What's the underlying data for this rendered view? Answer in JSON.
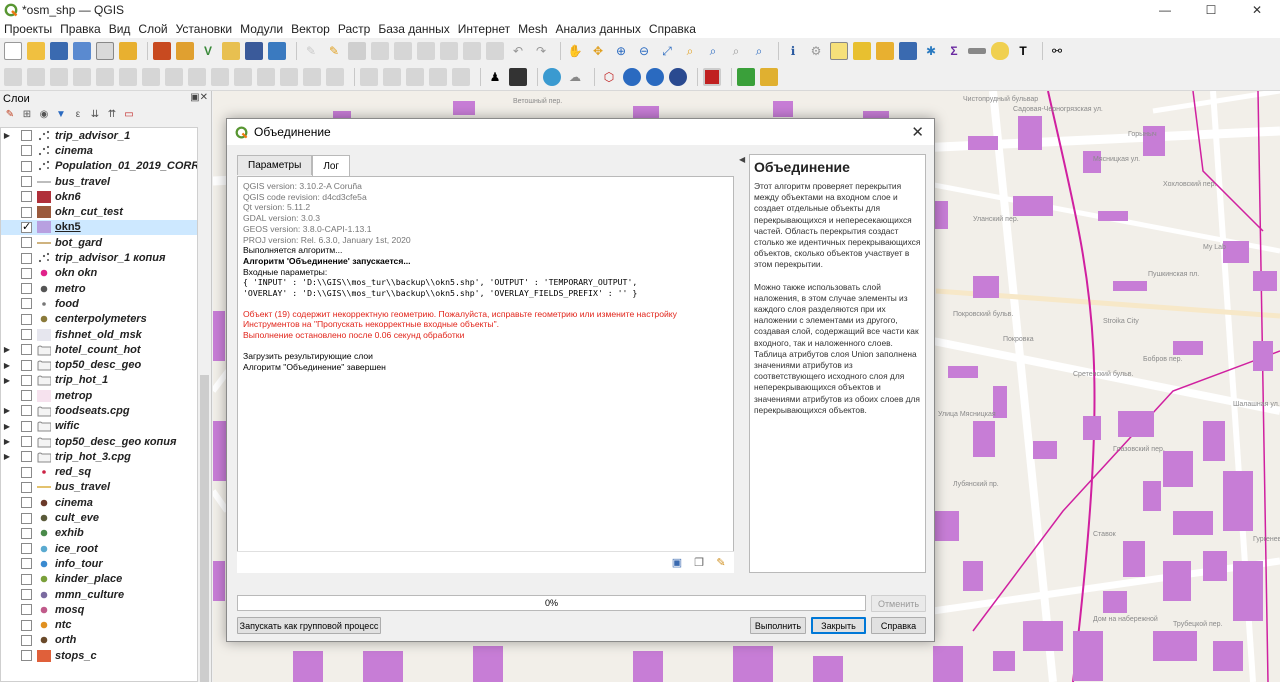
{
  "window": {
    "title": "*osm_shp — QGIS",
    "minimize": "—",
    "maximize": "☐",
    "close": "✕"
  },
  "menu": [
    "Проекты",
    "Правка",
    "Вид",
    "Слой",
    "Установки",
    "Модули",
    "Вектор",
    "Растр",
    "База данных",
    "Интернет",
    "Mesh",
    "Анализ данных",
    "Справка"
  ],
  "layers_panel": {
    "title": "Слои",
    "items": [
      {
        "name": "trip_advisor_1",
        "expander": "▶",
        "checked": false,
        "symbol": "points",
        "color": "#555555"
      },
      {
        "name": "cinema",
        "expander": "",
        "checked": false,
        "symbol": "points",
        "color": "#555555"
      },
      {
        "name": "Population_01_2019_CORRE",
        "expander": "",
        "checked": false,
        "symbol": "points",
        "color": "#555555"
      },
      {
        "name": "bus_travel",
        "expander": "",
        "checked": false,
        "symbol": "line",
        "color": "#999999"
      },
      {
        "name": "okn6",
        "expander": "",
        "checked": false,
        "symbol": "fill",
        "color": "#b0303a"
      },
      {
        "name": "okn_cut_test",
        "expander": "",
        "checked": false,
        "symbol": "fill",
        "color": "#9b5a3c"
      },
      {
        "name": "okn5",
        "expander": "",
        "checked": true,
        "symbol": "fill",
        "color": "#b8a0e0",
        "selected": true
      },
      {
        "name": "bot_gard",
        "expander": "",
        "checked": false,
        "symbol": "line",
        "color": "#b58a3a"
      },
      {
        "name": "trip_advisor_1 копия",
        "expander": "",
        "checked": false,
        "symbol": "points",
        "color": "#555555"
      },
      {
        "name": "okn okn",
        "expander": "",
        "checked": false,
        "symbol": "dot",
        "color": "#e0228a"
      },
      {
        "name": "metro",
        "expander": "",
        "checked": false,
        "symbol": "dot",
        "color": "#555555"
      },
      {
        "name": "food",
        "expander": "",
        "checked": false,
        "symbol": "smalldot",
        "color": "#777777"
      },
      {
        "name": "centerpolymeters",
        "expander": "",
        "checked": false,
        "symbol": "dot",
        "color": "#8a7a3a"
      },
      {
        "name": "fishnet_old_msk",
        "expander": "",
        "checked": false,
        "symbol": "fill",
        "color": "#e6e6ee"
      },
      {
        "name": "hotel_count_hot",
        "expander": "▶",
        "checked": false,
        "symbol": "group",
        "color": "#888888"
      },
      {
        "name": "top50_desc_geo",
        "expander": "▶",
        "checked": false,
        "symbol": "group",
        "color": "#888888"
      },
      {
        "name": "trip_hot_1",
        "expander": "▶",
        "checked": false,
        "symbol": "group",
        "color": "#888888"
      },
      {
        "name": "metrop",
        "expander": "",
        "checked": false,
        "symbol": "fill",
        "color": "#f6e2ee"
      },
      {
        "name": "foodseats.cpg",
        "expander": "▶",
        "checked": false,
        "symbol": "group",
        "color": "#888888"
      },
      {
        "name": "wific",
        "expander": "▶",
        "checked": false,
        "symbol": "group",
        "color": "#888888"
      },
      {
        "name": "top50_desc_geo копия",
        "expander": "▶",
        "checked": false,
        "symbol": "group",
        "color": "#888888"
      },
      {
        "name": "trip_hot_3.cpg",
        "expander": "▶",
        "checked": false,
        "symbol": "group",
        "color": "#888888"
      },
      {
        "name": "red_sq",
        "expander": "",
        "checked": false,
        "symbol": "smalldot",
        "color": "#cc2244"
      },
      {
        "name": "bus_travel",
        "expander": "",
        "checked": false,
        "symbol": "line",
        "color": "#d4a020"
      },
      {
        "name": "cinema",
        "expander": "",
        "checked": false,
        "symbol": "dot",
        "color": "#6b3a2a"
      },
      {
        "name": "cult_eve",
        "expander": "",
        "checked": false,
        "symbol": "dot",
        "color": "#5a5a3a"
      },
      {
        "name": "exhib",
        "expander": "",
        "checked": false,
        "symbol": "dot",
        "color": "#4a8a4a"
      },
      {
        "name": "ice_root",
        "expander": "",
        "checked": false,
        "symbol": "dot",
        "color": "#5aaad0"
      },
      {
        "name": "info_tour",
        "expander": "",
        "checked": false,
        "symbol": "dot",
        "color": "#3a8ad0"
      },
      {
        "name": "kinder_place",
        "expander": "",
        "checked": false,
        "symbol": "dot",
        "color": "#7aa03a"
      },
      {
        "name": "mmn_culture",
        "expander": "",
        "checked": false,
        "symbol": "dot",
        "color": "#7a6aa0"
      },
      {
        "name": "mosq",
        "expander": "",
        "checked": false,
        "symbol": "dot",
        "color": "#c05a8a"
      },
      {
        "name": "ntc",
        "expander": "",
        "checked": false,
        "symbol": "dot",
        "color": "#e09020"
      },
      {
        "name": "orth",
        "expander": "",
        "checked": false,
        "symbol": "dot",
        "color": "#6a4a2a"
      },
      {
        "name": "stops_c",
        "expander": "",
        "checked": false,
        "symbol": "fill",
        "color": "#e0603a"
      }
    ]
  },
  "map": {
    "labels": [
      "Ветошный пер.",
      "Чистопрудный бульвар",
      "Мясницкая ул.",
      "Сретенский бульв.",
      "Покровский бульв.",
      "Хохловский пер.",
      "My Lab",
      "Горыныч",
      "Бобров пер.",
      "Уланский пер.",
      "Пушкинская пл.",
      "Ставок",
      "Глазовский пер.",
      "Улица Мясницкая",
      "Трубецкой пер.",
      "Садовая-Черногрязская ул.",
      "Гургенев",
      "Лубянский пр.",
      "Дом на набережной",
      "Покровка",
      "Stroika City",
      "Шалашная ул."
    ]
  },
  "dialog": {
    "title": "Объединение",
    "close": "✕",
    "tabs": [
      {
        "label": "Параметры",
        "active": false
      },
      {
        "label": "Лог",
        "active": true
      }
    ],
    "log": [
      {
        "text": "QGIS version: 3.10.2-A Coruña",
        "style": "gray"
      },
      {
        "text": "QGIS code revision: d4cd3cfe5a",
        "style": "gray"
      },
      {
        "text": "Qt version: 5.11.2",
        "style": "gray"
      },
      {
        "text": "GDAL version: 3.0.3",
        "style": "gray"
      },
      {
        "text": "GEOS version: 3.8.0-CAPI-1.13.1",
        "style": "gray"
      },
      {
        "text": "PROJ version: Rel. 6.3.0, January 1st, 2020",
        "style": "gray"
      },
      {
        "text": "Выполняется алгоритм...",
        "style": "black"
      },
      {
        "text": "Алгоритм 'Объединение' запускается...",
        "style": "bold"
      },
      {
        "text": "Входные параметры:",
        "style": "black"
      },
      {
        "text": "{ 'INPUT' : 'D:\\\\GIS\\\\mos_tur\\\\backup\\\\okn5.shp', 'OUTPUT' : 'TEMPORARY_OUTPUT',",
        "style": "mono"
      },
      {
        "text": "'OVERLAY' : 'D:\\\\GIS\\\\mos_tur\\\\backup\\\\okn5.shp', 'OVERLAY_FIELDS_PREFIX' : '' }",
        "style": "mono"
      },
      {
        "text": "",
        "style": "gap"
      },
      {
        "text": "Объект (19) содержит некорректную геометрию. Пожалуйста, исправьте геометрию или измените настройку",
        "style": "red"
      },
      {
        "text": "Инструментов на \"Пропускать некорректные входные объекты\".",
        "style": "red"
      },
      {
        "text": "Выполнение остановлено после 0.06 секунд обработки",
        "style": "red"
      },
      {
        "text": "",
        "style": "gap"
      },
      {
        "text": "Загрузить результирующие слои",
        "style": "black"
      },
      {
        "text": "Алгоритм \"Объединение\" завершен",
        "style": "black"
      }
    ],
    "help_title": "Объединение",
    "help_paragraphs": [
      "Этот алгоритм проверяет перекрытия между объектами на входном слое и создает отдельные объекты для перекрывающихся и непересекающихся частей. Область перекрытия создаст столько же идентичных перекрывающихся объектов, сколько объектов участвует в этом перекрытии.",
      "Можно также использовать слой наложения, в этом случае элементы из каждого слоя разделяются при их наложении с элементами из другого, создавая слой, содержащий все части как входного, так и наложенного слоев. Таблица атрибутов слоя Union заполнена значениями атрибутов из соответствующего исходного слоя для неперекрывающихся объектов и значениями атрибутов из обоих слоев для перекрывающихся объектов."
    ],
    "progress_text": "0%",
    "progress_value": 0,
    "cancel_label": "Отменить",
    "batch_label": "Запускать как групповой процесс",
    "run_label": "Выполнить",
    "close_label": "Закрыть",
    "help_label": "Справка"
  }
}
